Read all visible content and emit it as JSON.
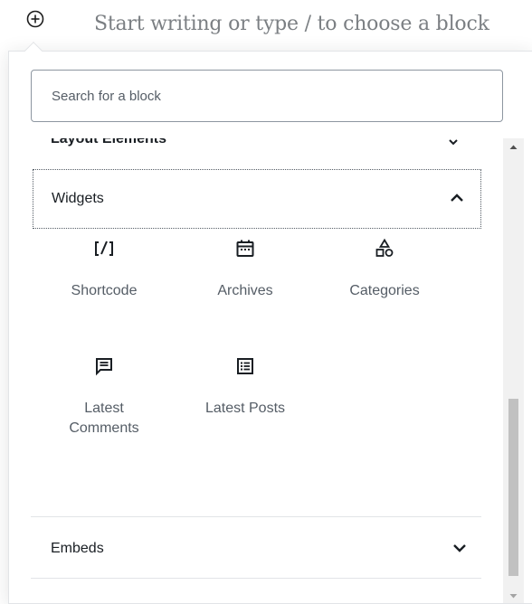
{
  "editor": {
    "placeholder": "Start writing or type / to choose a block",
    "add_block_icon": "plus-circle-icon"
  },
  "inserter": {
    "search_placeholder": "Search for a block",
    "panels": {
      "layout": {
        "title": "Layout Elements",
        "chevron": "chevron-down-icon"
      },
      "widgets": {
        "title": "Widgets",
        "expanded": true,
        "chevron": "chevron-up-icon",
        "blocks": [
          {
            "label": "Shortcode",
            "icon": "shortcode-icon"
          },
          {
            "label": "Archives",
            "icon": "calendar-icon"
          },
          {
            "label": "Categories",
            "icon": "categories-icon"
          },
          {
            "label": "Latest Comments",
            "icon": "comment-icon"
          },
          {
            "label": "Latest Posts",
            "icon": "list-icon"
          }
        ]
      },
      "embeds": {
        "title": "Embeds",
        "expanded": false,
        "chevron": "chevron-down-icon"
      }
    }
  },
  "colors": {
    "text_dark": "#191e23",
    "text_muted": "#555d66",
    "placeholder": "#7b7f83",
    "border": "#e2e4e7",
    "scrollbar_thumb": "#c1c1c1"
  }
}
